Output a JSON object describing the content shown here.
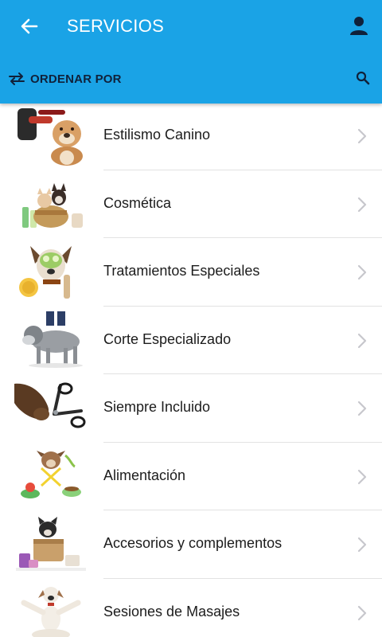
{
  "header": {
    "title": "SERVICIOS",
    "sort_label": "ORDENAR POR"
  },
  "colors": {
    "appbar": "#1aa3e6",
    "title_text": "#ffffff",
    "icon_dark": "#10213a",
    "list_text": "#1c1c1c",
    "chevron": "#c7c7cc",
    "divider": "#e2e2e2"
  },
  "icons": {
    "back": "arrow-left-icon",
    "profile": "person-icon",
    "sort": "swap-arrows-icon",
    "search": "search-icon",
    "row_action": "chevron-right-icon"
  },
  "services": [
    {
      "label": "Estilismo Canino",
      "image": "bulldog-grooming-photo"
    },
    {
      "label": "Cosmética",
      "image": "dogs-in-basket-cosmetics-photo"
    },
    {
      "label": "Tratamientos Especiales",
      "image": "dog-facial-mask-photo"
    },
    {
      "label": "Corte Especializado",
      "image": "schnauzer-haircut-photo"
    },
    {
      "label": "Siempre Incluido",
      "image": "paw-nail-clipper-photo"
    },
    {
      "label": "Alimentación",
      "image": "dog-food-bowls-photo"
    },
    {
      "label": "Accesorios y complementos",
      "image": "dog-accessories-basket-photo"
    },
    {
      "label": "Sesiones de Masajes",
      "image": "dog-yoga-meditation-photo"
    }
  ]
}
